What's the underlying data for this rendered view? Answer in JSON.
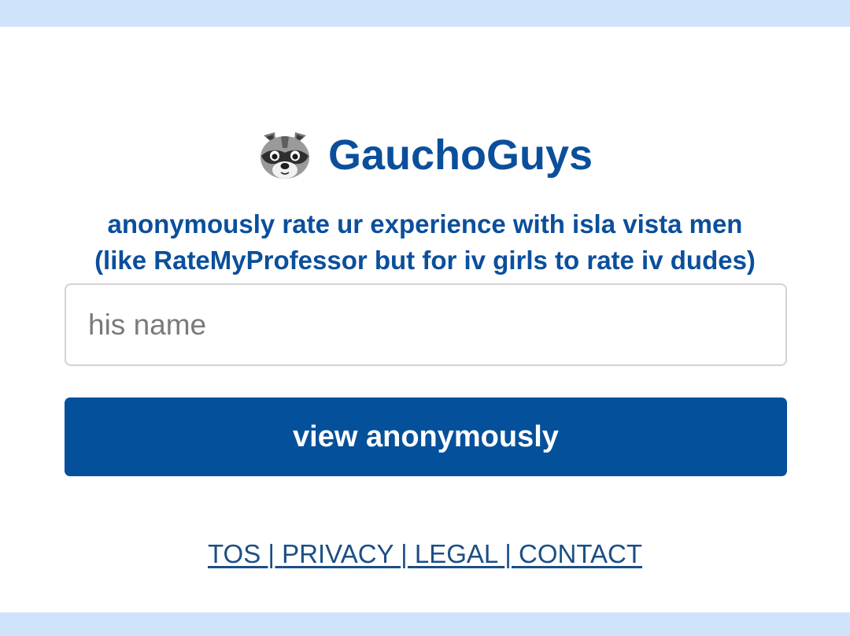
{
  "colors": {
    "page_background": "#cfe3fb",
    "brand_blue": "#0b4f9c",
    "button_blue": "#05509b",
    "link_blue": "#1b4f86"
  },
  "brand": {
    "icon": "raccoon-icon",
    "name": "GauchoGuys"
  },
  "tagline": {
    "line1": "anonymously rate ur experience with isla vista men",
    "line2": "(like RateMyProfessor but for iv girls to rate iv dudes)"
  },
  "search": {
    "placeholder": "his name",
    "value": ""
  },
  "view_button": {
    "label": "view anonymously"
  },
  "footer": {
    "tos": "TOS ",
    "sep1": "| ",
    "privacy": "PRIVACY ",
    "sep2": "| ",
    "legal": "LEGAL ",
    "sep3": "| ",
    "contact": "CONTACT"
  }
}
